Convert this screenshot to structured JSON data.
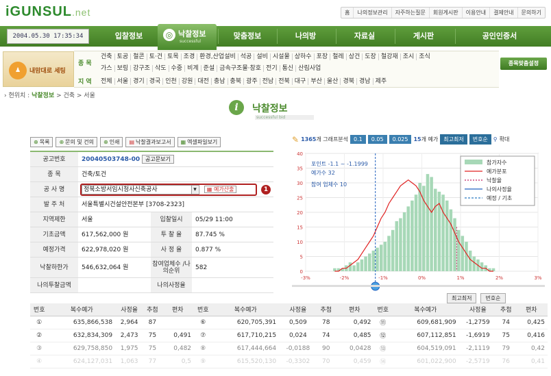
{
  "brand": {
    "logo_main": "iGUNSUL",
    "logo_suffix": ".net"
  },
  "toplinks": [
    "홈",
    "나의정보관리",
    "자주하는질문",
    "회원게시판",
    "이용안내",
    "결제안내",
    "문의하기"
  ],
  "datetime": "2004.05.30 17:35:34",
  "nav": {
    "items": [
      "입찰정보",
      "낙찰정보",
      "맞춤정보",
      "나의방",
      "자료실",
      "게시판",
      "공인인증서"
    ],
    "active": "낙찰정보",
    "active_sub": "successful"
  },
  "left_button": "내맘대로 세팅",
  "filters": {
    "label_type": "종 목",
    "label_region": "지 역",
    "types_row1": [
      "건축",
      "토공",
      "철콘",
      "토·건",
      "토목",
      "조경",
      "환경,산업설비",
      "석공",
      "설비",
      "시설물",
      "상하수",
      "포장",
      "철레",
      "상건",
      "도장",
      "철강재",
      "조시",
      "조식"
    ],
    "types_row2": [
      "가스",
      "보링",
      "강구조",
      "삭도",
      "수중",
      "비계",
      "준설",
      "금속구조물·창호",
      "전기",
      "통신",
      "산림사업"
    ],
    "regions": [
      "전체",
      "서울",
      "경기",
      "경국",
      "인천",
      "강원",
      "대전",
      "충남",
      "충북",
      "광주",
      "전남",
      "전북",
      "대구",
      "부산",
      "울산",
      "경북",
      "경남",
      "제주"
    ],
    "settings_button": "종목맞춤설정"
  },
  "breadcrumb": {
    "prefix": "› 현위치 :",
    "current": "낙찰정보",
    "rest": "> 건축 > 서울"
  },
  "page_title": {
    "title": "낙찰정보",
    "sub": "successful bid"
  },
  "actions": [
    "목록",
    "문의 및 건의",
    "인쇄",
    "낙찰결과보고서",
    "엑셀파일보기"
  ],
  "info": {
    "notice_no_label": "공고번호",
    "notice_no": "20040503748-00",
    "notice_btn": "공고문보기",
    "kind_label": "종 목",
    "kind": "건축/토건",
    "project_label": "공 사 명",
    "project": "정북소방서임시청사신축공사",
    "project_btn": "예가산출",
    "project_marker": "1",
    "client_label": "발 주 처",
    "client": "서울특별시건설안전본부   [3708-2323]",
    "region_label": "지역제한",
    "region": "서울",
    "date_label": "입찰일시",
    "date": "05/29 11:00",
    "base_label": "기초금액",
    "base": "617,562,000 원",
    "rate_label": "투 찰 율",
    "rate": "87.745 %",
    "est_label": "예정가격",
    "est": "622,978,020 원",
    "adj_label": "사 정 율",
    "adj": "0.877 %",
    "low_label": "낙찰하한가",
    "low": "546,632,064 원",
    "bidders_label": "참여업체수 /나의순위",
    "bidders": "582",
    "mybid_label": "나의투찰금액",
    "mybid": "",
    "myadj_label": "나의사정율",
    "myadj": ""
  },
  "graph_bar": {
    "count": "1365",
    "count_suffix": "개 그래프분석",
    "b1": "0.1",
    "b2": "0.05",
    "b3": "0.025",
    "n": "15",
    "n_suffix": "개 예가",
    "b4": "최고최저",
    "b5": "번호순",
    "zoom": "확대"
  },
  "chart_data": {
    "type": "bar",
    "x_ticks": [
      "-3%",
      "-2%",
      "-1%",
      "0%",
      "1%",
      "2%",
      "3%"
    ],
    "ylim": [
      0,
      40
    ],
    "y_ticks": [
      0,
      5,
      10,
      15,
      20,
      25,
      30,
      35,
      40
    ],
    "x": [
      -2.25,
      -2.15,
      -2.05,
      -1.95,
      -1.85,
      -1.75,
      -1.65,
      -1.55,
      -1.45,
      -1.35,
      -1.25,
      -1.15,
      -1.05,
      -0.95,
      -0.85,
      -0.75,
      -0.65,
      -0.55,
      -0.45,
      -0.35,
      -0.25,
      -0.15,
      -0.05,
      0.05,
      0.15,
      0.25,
      0.35,
      0.45,
      0.55,
      0.65,
      0.75,
      0.85,
      0.95,
      1.05,
      1.15,
      1.25,
      1.35,
      1.45,
      1.55,
      1.65,
      1.75,
      1.85
    ],
    "series": [
      {
        "name": "참가자수",
        "values": [
          1,
          1,
          1,
          2,
          3,
          2,
          3,
          4,
          5,
          6,
          7,
          8,
          9,
          10,
          12,
          14,
          17,
          18,
          20,
          22,
          24,
          26,
          30,
          29,
          33,
          32,
          28,
          27,
          26,
          24,
          21,
          18,
          14,
          12,
          10,
          7,
          5,
          4,
          3,
          2,
          1,
          1
        ]
      },
      {
        "name": "예가분포",
        "values": [
          0,
          0,
          1,
          1,
          2,
          3,
          4,
          6,
          8,
          10,
          12,
          15,
          18,
          20,
          23,
          25,
          27,
          29,
          30,
          31,
          30,
          29,
          27,
          24,
          22,
          20,
          22,
          23,
          20,
          18,
          16,
          13,
          10,
          8,
          6,
          4,
          3,
          2,
          1,
          1,
          0,
          0
        ]
      }
    ],
    "legend": [
      "참가자수",
      "예가분포",
      "낙찰율",
      "나의사정율",
      "예정 / 기초"
    ],
    "annotations": {
      "point": "포인트  -1.1 ~ -1.1999",
      "est_count": "예가수 32",
      "bidders": "참여 업체수  10"
    },
    "vline_blue": -1.2,
    "vline_pink": 0.9
  },
  "compare_buttons": [
    "최고최저",
    "번호순"
  ],
  "table": {
    "headers": [
      "번호",
      "복수예가",
      "사정율",
      "추첨",
      "편차",
      "번호",
      "복수예가",
      "사정율",
      "추첨",
      "편차",
      "번호",
      "복수예가",
      "사정율",
      "추첨",
      "편차"
    ],
    "rows": [
      [
        "①",
        "635,866,538",
        "2,964",
        "87",
        "",
        "⑥",
        "620,705,391",
        "0,509",
        "78",
        "0,492",
        "⑪",
        "609,681,909",
        "-1,2759",
        "74",
        "0,425"
      ],
      [
        "②",
        "632,834,309",
        "2,473",
        "75",
        "0,491",
        "⑦",
        "617,710,215",
        "0,024",
        "74",
        "0,485",
        "⑫",
        "607,112,851",
        "-1,6919",
        "75",
        "0,416"
      ],
      [
        "③",
        "629,758,850",
        "1,975",
        "75",
        "0,482",
        "⑧",
        "617,444,664",
        "-0,0188",
        "90",
        "0,0428",
        "⑬",
        "604,519,091",
        "-2,1119",
        "79",
        "0,42"
      ],
      [
        "④",
        "624,127,031",
        "1,063",
        "77",
        "0,5",
        "⑨",
        "615,520,130",
        "-0,3302",
        "70",
        "0,459",
        "⑭",
        "601,022,900",
        "-2,5719",
        "76",
        "0,41"
      ]
    ]
  }
}
